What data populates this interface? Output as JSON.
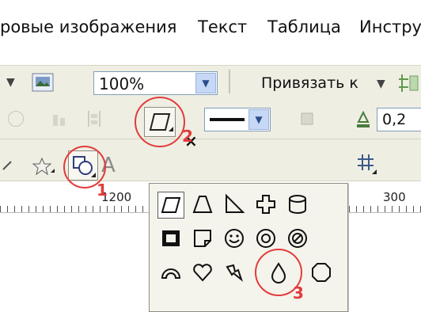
{
  "menu": {
    "items": [
      {
        "label": "ровые изображения"
      },
      {
        "label": "Текст"
      },
      {
        "label": "Таблица"
      },
      {
        "label": "Инстру"
      }
    ]
  },
  "toolbar1": {
    "zoom_value": "100%",
    "snap_label": "Привязать к"
  },
  "toolbar2": {
    "outline_width": "0,2"
  },
  "ruler": {
    "labels": [
      "1200",
      "300"
    ]
  },
  "annotations": {
    "marker_1": "1",
    "marker_2": "2",
    "marker_3": "3",
    "color": "#e23b3b"
  },
  "popup": {
    "close_label": "×",
    "shapes": [
      "parallelogram-icon",
      "trapezoid-icon",
      "right-triangle-icon",
      "cross-icon",
      "cylinder-icon",
      "frame-icon",
      "folded-corner-icon",
      "smiley-icon",
      "donut-icon",
      "no-symbol-icon",
      "arc-icon",
      "heart-icon",
      "lightning-icon",
      "teardrop-icon",
      "octagon-icon"
    ]
  }
}
